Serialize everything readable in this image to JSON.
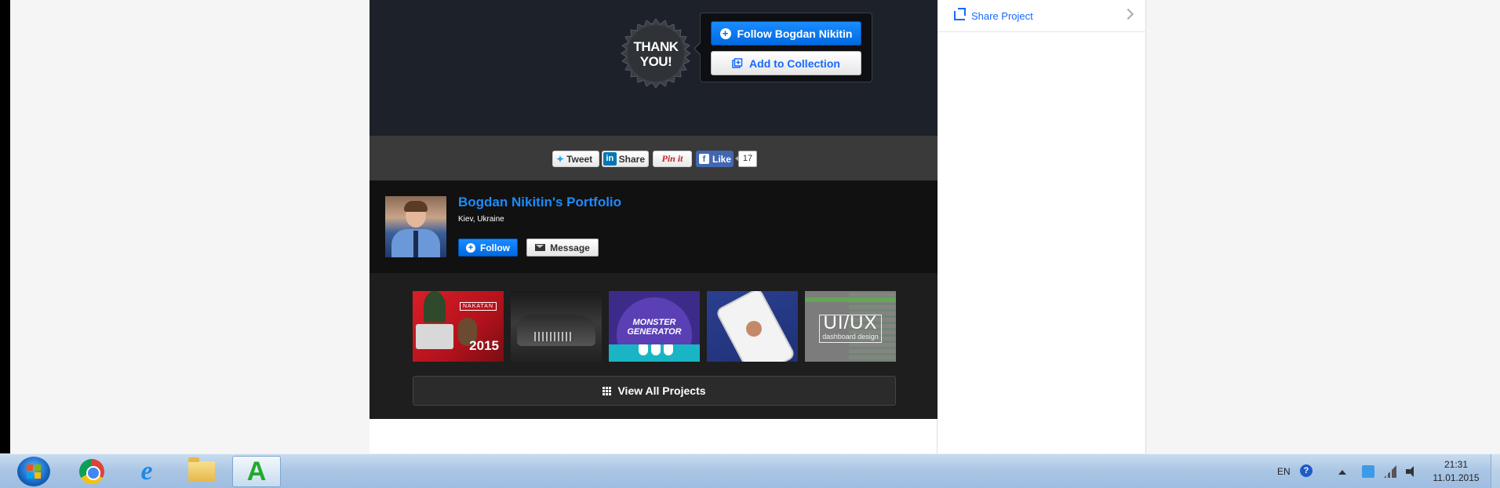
{
  "badge": {
    "text": "THANK\nYOU!"
  },
  "cta": {
    "follow_label": "Follow Bogdan Nikitin",
    "collection_label": "Add to Collection"
  },
  "share": {
    "tweet": "Tweet",
    "linkedin_mark": "in",
    "linkedin": "Share",
    "pinit": "Pin it",
    "like": "Like",
    "like_count": "17"
  },
  "owner": {
    "name": "Bogdan Nikitin's Portfolio",
    "location": "Kiev, Ukraine",
    "follow": "Follow",
    "message": "Message"
  },
  "projects": {
    "thumbs": [
      {
        "badge": "NAKATAN",
        "year": "2015"
      },
      {},
      {
        "text": "MONSTER\nGENERATOR"
      },
      {},
      {
        "big": "UI/UX",
        "sub": "dashboard design"
      }
    ],
    "view_all": "View All Projects"
  },
  "sidebar": {
    "share_project": "Share Project"
  },
  "taskbar": {
    "lang": "EN",
    "help": "?",
    "time": "21:31",
    "date": "11.01.2015"
  },
  "colors": {
    "accent_blue": "#1769ff",
    "dark_panel": "#1d212a"
  }
}
